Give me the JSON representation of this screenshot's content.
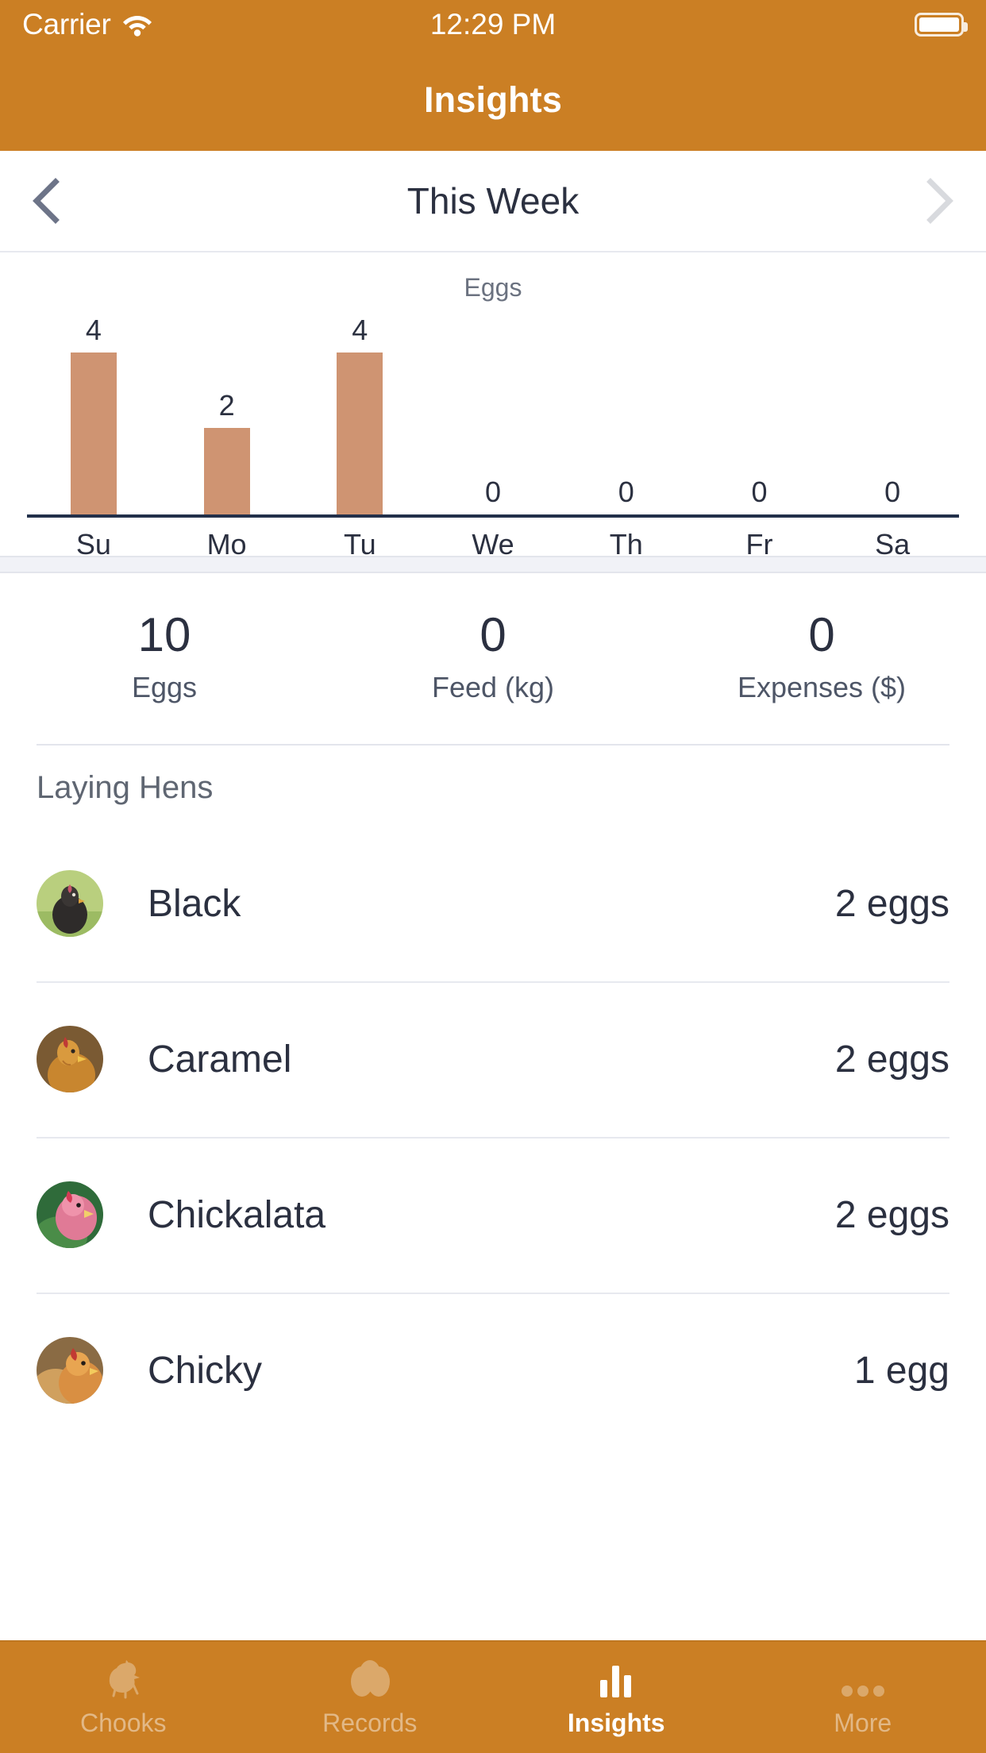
{
  "status_bar": {
    "carrier": "Carrier",
    "time": "12:29 PM",
    "wifi_icon": "wifi-icon",
    "battery_icon": "battery-full-icon"
  },
  "header": {
    "title": "Insights",
    "background": "#cb7f24"
  },
  "week_selector": {
    "prev_label": "chevron-left-icon",
    "next_label": "chevron-right-icon",
    "current": "This Week"
  },
  "chart_data": {
    "type": "bar",
    "title": "Eggs",
    "categories": [
      "Su",
      "Mo",
      "Tu",
      "We",
      "Th",
      "Fr",
      "Sa"
    ],
    "values": [
      4,
      2,
      4,
      0,
      0,
      0,
      0
    ],
    "value_labels": [
      "4",
      "2",
      "4",
      "0",
      "0",
      "0",
      "0"
    ],
    "xlabel": "",
    "ylabel": "",
    "ylim": [
      0,
      4
    ],
    "grid": false,
    "legend": "none",
    "bar_color": "#cf9472",
    "axis_color": "#22304a"
  },
  "summary": {
    "stats": [
      {
        "value": "10",
        "label": "Eggs"
      },
      {
        "value": "0",
        "label": "Feed (kg)"
      },
      {
        "value": "0",
        "label": "Expenses ($)"
      }
    ]
  },
  "laying_hens": {
    "title": "Laying Hens",
    "rows": [
      {
        "name": "Black",
        "count": "2 eggs",
        "avatar": "hen-photo-black"
      },
      {
        "name": "Caramel",
        "count": "2 eggs",
        "avatar": "hen-photo-caramel"
      },
      {
        "name": "Chickalata",
        "count": "2 eggs",
        "avatar": "hen-photo-chickalata"
      },
      {
        "name": "Chicky",
        "count": "1 egg",
        "avatar": "hen-photo-chicky"
      }
    ]
  },
  "tab_bar": {
    "background": "#cb7f24",
    "active_color": "#ffffff",
    "inactive_color": "#e2b886",
    "items": [
      {
        "label": "Chooks",
        "icon": "chicken-icon",
        "active": false
      },
      {
        "label": "Records",
        "icon": "eggs-icon",
        "active": false
      },
      {
        "label": "Insights",
        "icon": "bar-chart-icon",
        "active": true
      },
      {
        "label": "More",
        "icon": "ellipsis-icon",
        "active": false
      }
    ]
  }
}
